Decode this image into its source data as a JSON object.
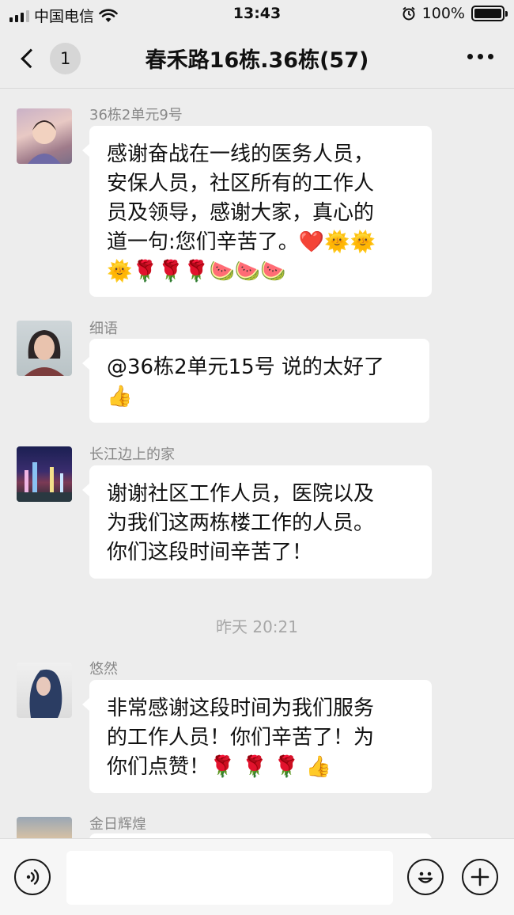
{
  "status_bar": {
    "carrier": "中国电信",
    "time": "13:43",
    "battery": "100%",
    "battery_level": 1.0
  },
  "nav": {
    "unread_count": "1",
    "title": "春禾路16栋.36栋(57)"
  },
  "messages": [
    {
      "sender": "36栋2单元9号",
      "lines": [
        "感谢奋战在一线的医务人员，",
        "安保人员，社区所有的工作人",
        "员及领导，感谢大家，真心的",
        "道一句:您们辛苦了。❤️🌞🌞",
        "🌞🌹🌹🌹🍉🍉🍉"
      ]
    },
    {
      "sender": "细语",
      "lines": [
        "@36栋2单元15号 说的太好了",
        "👍"
      ]
    },
    {
      "sender": "长江边上的家",
      "lines": [
        "谢谢社区工作人员，医院以及",
        "为我们这两栋楼工作的人员。",
        "你们这段时间辛苦了！"
      ]
    },
    {
      "sender": "悠然",
      "lines": [
        "非常感谢这段时间为我们服务",
        "的工作人员！你们辛苦了！为",
        "你们点赞！🌹 🌹 🌹 👍"
      ]
    },
    {
      "sender": "金日辉煌",
      "lines": []
    }
  ],
  "timestamp": "昨天 20:21",
  "input": {
    "value": ""
  },
  "icons": {
    "back": "chevron-left-icon",
    "more": "more-dots-icon",
    "voice": "voice-icon",
    "emoji": "emoji-icon",
    "add": "plus-icon"
  }
}
